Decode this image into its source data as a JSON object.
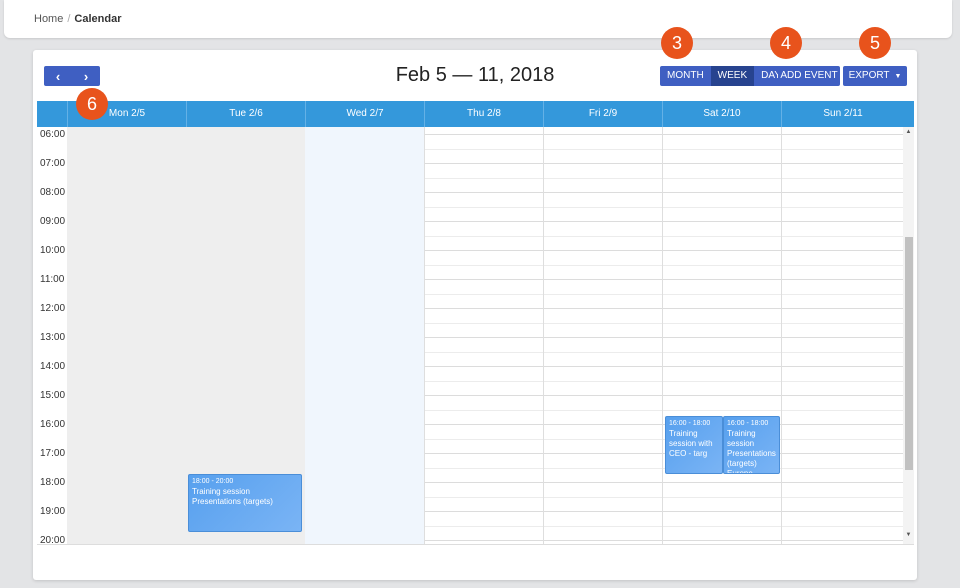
{
  "breadcrumb": {
    "home": "Home",
    "separator": "/",
    "current": "Calendar"
  },
  "calendar": {
    "title": "Feb 5 — 11, 2018",
    "prev_icon": "‹",
    "next_icon": "›",
    "views": [
      {
        "label": "MONTH",
        "active": false
      },
      {
        "label": "WEEK",
        "active": true
      },
      {
        "label": "DAY",
        "active": false
      }
    ],
    "add_event_label": "ADD EVENT",
    "export_label": "EXPORT",
    "export_caret": "▼",
    "days": [
      "Mon 2/5",
      "Tue 2/6",
      "Wed 2/7",
      "Thu 2/8",
      "Fri 2/9",
      "Sat 2/10",
      "Sun 2/11"
    ],
    "times": [
      "06:00",
      "07:00",
      "08:00",
      "09:00",
      "10:00",
      "11:00",
      "12:00",
      "13:00",
      "14:00",
      "15:00",
      "16:00",
      "17:00",
      "18:00",
      "19:00",
      "20:00"
    ],
    "events": [
      {
        "time": "18:00 - 20:00",
        "title": "Training session Presentations (targets)"
      },
      {
        "time": "16:00 - 18:00",
        "title": "Training session with CEO - targ"
      },
      {
        "time": "16:00 - 18:00",
        "title": "Training session Presentations (targets) Europe"
      }
    ],
    "colors": {
      "primary": "#3f5fc2",
      "header": "#3498db",
      "event": "#6aaaf2",
      "today_bg": "#f0f6fd",
      "past_bg": "#eeeeee",
      "callout": "#e8531c"
    }
  },
  "callouts": [
    "3",
    "4",
    "5",
    "6"
  ]
}
